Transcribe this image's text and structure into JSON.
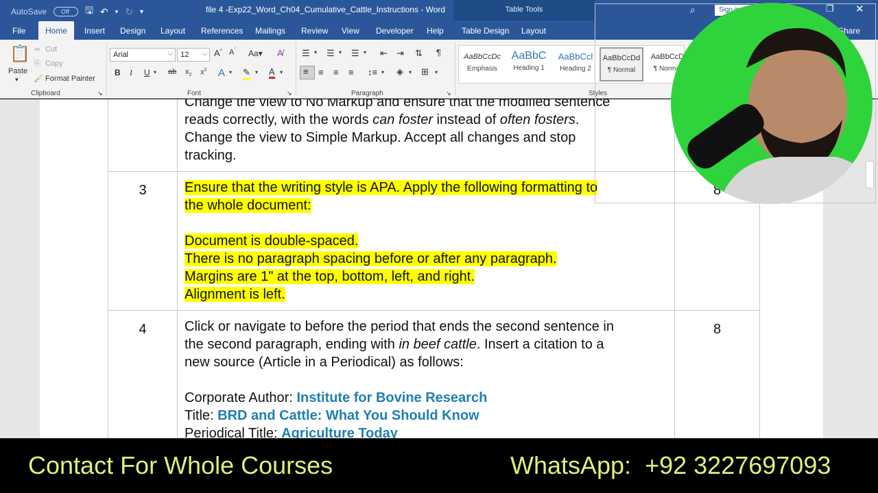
{
  "titlebar": {
    "autosave": "AutoSave",
    "autosave_state": "Off",
    "title": "file 4 -Exp22_Word_Ch04_Cumulative_Cattle_Instructions - Word",
    "table_tools": "Table Tools",
    "sign_in": "Sign in"
  },
  "tabs": [
    "File",
    "Home",
    "Insert",
    "Design",
    "Layout",
    "References",
    "Mailings",
    "Review",
    "View",
    "Developer",
    "Help",
    "Table Design",
    "Layout"
  ],
  "share": "Share",
  "clipboard": {
    "paste": "Paste",
    "cut": "Cut",
    "copy": "Copy",
    "format_painter": "Format Painter",
    "label": "Clipboard"
  },
  "font": {
    "name": "Arial",
    "size": "12",
    "label": "Font"
  },
  "paragraph": {
    "label": "Paragraph"
  },
  "styles": {
    "label": "Styles",
    "items": [
      {
        "preview": "AaBbCcDc",
        "name": "Emphasis"
      },
      {
        "preview": "AaBbC",
        "name": "Heading 1"
      },
      {
        "preview": "AaBbCcl",
        "name": "Heading 2"
      },
      {
        "preview": "AaBbCcDd",
        "name": "¶ Normal"
      },
      {
        "preview": "AaBbCcD",
        "name": "¶ Normal"
      }
    ]
  },
  "document": {
    "row2_lines": [
      "Change the view to No Markup and ensure that the modified sentence",
      "Change the view to Simple Markup. Accept all changes and stop",
      "tracking."
    ],
    "row2_line2_a": "reads correctly, with the words ",
    "row2_line2_i1": "can foster",
    "row2_line2_b": " instead of ",
    "row2_line2_i2": "often fosters",
    "row2_line2_c": ".",
    "row3_num": "3",
    "row3_points": "8",
    "row3_lines": [
      "Ensure that the writing style is APA. Apply the following formatting to",
      "the whole document:",
      "Document is double-spaced.",
      "There is no paragraph spacing before or after any paragraph.",
      "Margins are 1\" at the top, bottom, left, and right.",
      "Alignment is left."
    ],
    "row4_num": "4",
    "row4_points": "8",
    "row4_line1": "Click or navigate to before the period that ends the second sentence in",
    "row4_line2_a": "the second paragraph, ending with ",
    "row4_line2_i": "in beef cattle",
    "row4_line2_b": ". Insert a citation to a",
    "row4_line3": "new source (Article in a Periodical) as follows:",
    "corp_label": "Corporate Author: ",
    "corp_value": "Institute for Bovine Research",
    "title_label": "Title: ",
    "title_value": "BRD and Cattle: What You Should Know",
    "periodical_label": "Periodical Title: ",
    "periodical_value": "Agriculture Today"
  },
  "banner": {
    "left": "Contact For Whole Courses",
    "right": "WhatsApp:  +92 3227697093"
  },
  "colors": {
    "word_blue": "#2b579a",
    "highlight": "#ffff00",
    "citation_teal": "#1f7fb0",
    "banner_text": "#e2ee7a",
    "cam_green": "#2fd43c"
  }
}
